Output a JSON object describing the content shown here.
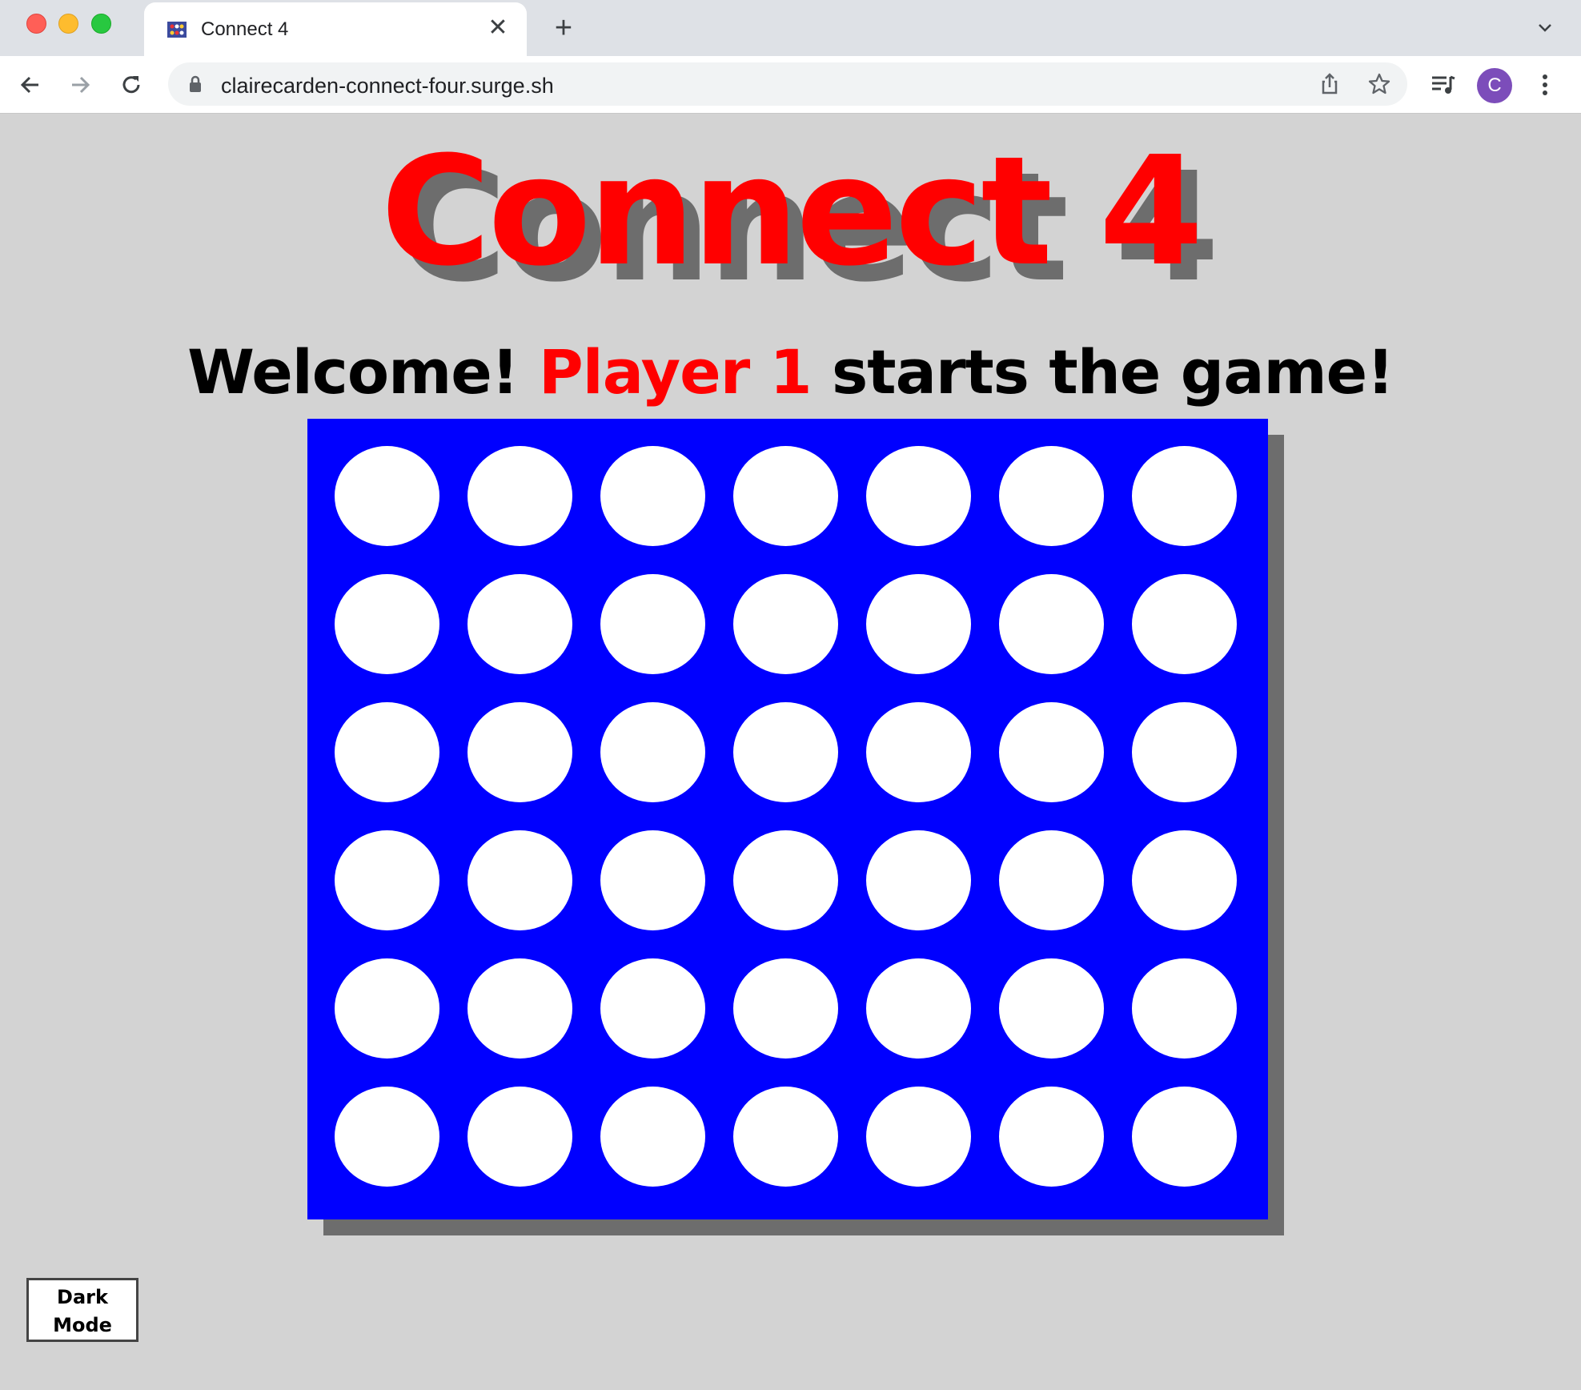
{
  "browser": {
    "tab_title": "Connect 4",
    "url": "clairecarden-connect-four.surge.sh",
    "profile_initial": "C"
  },
  "game": {
    "title": "Connect 4",
    "status_prefix": "Welcome! ",
    "status_player": "Player 1",
    "status_suffix": " starts the game!",
    "rows": 6,
    "columns": 7,
    "board_color": "#0000ff",
    "empty_slot_color": "#ffffff",
    "player1_color": "#ff0000",
    "board_state": [
      [
        "empty",
        "empty",
        "empty",
        "empty",
        "empty",
        "empty",
        "empty"
      ],
      [
        "empty",
        "empty",
        "empty",
        "empty",
        "empty",
        "empty",
        "empty"
      ],
      [
        "empty",
        "empty",
        "empty",
        "empty",
        "empty",
        "empty",
        "empty"
      ],
      [
        "empty",
        "empty",
        "empty",
        "empty",
        "empty",
        "empty",
        "empty"
      ],
      [
        "empty",
        "empty",
        "empty",
        "empty",
        "empty",
        "empty",
        "empty"
      ],
      [
        "empty",
        "empty",
        "empty",
        "empty",
        "empty",
        "empty",
        "empty"
      ]
    ]
  },
  "controls": {
    "dark_mode_line1": "Dark",
    "dark_mode_line2": "Mode"
  },
  "icons": [
    "close-icon",
    "new-tab-icon",
    "back-icon",
    "forward-icon",
    "reload-icon",
    "lock-icon",
    "share-icon",
    "star-icon",
    "media-icon",
    "kebab-icon",
    "chevron-down-icon"
  ]
}
